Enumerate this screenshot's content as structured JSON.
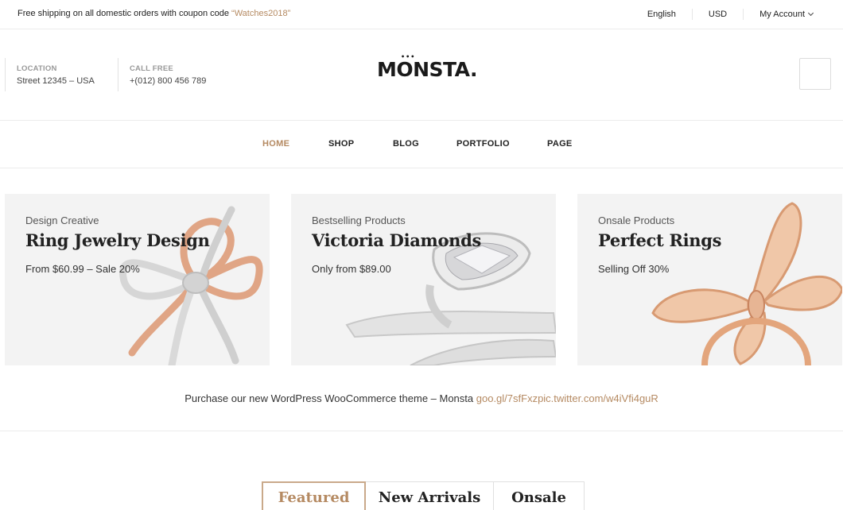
{
  "topbar": {
    "promo_text": "Free shipping on all domestic orders with coupon code ",
    "promo_code": "“Watches2018”",
    "language": "English",
    "currency": "USD",
    "account": "My Account"
  },
  "header": {
    "location_label": "LOCATION",
    "location_value": "Street 12345 – USA",
    "call_label": "CALL FREE",
    "call_value": "+(012) 800 456 789",
    "logo": "MONSTA."
  },
  "nav": {
    "items": [
      "HOME",
      "SHOP",
      "BLOG",
      "PORTFOLIO",
      "PAGE"
    ],
    "active": "HOME"
  },
  "banners": [
    {
      "subtitle": "Design Creative",
      "title": "Ring Jewelry Design",
      "desc": "From $60.99 – Sale 20%"
    },
    {
      "subtitle": "Bestselling Products",
      "title": "Victoria Diamonds",
      "desc": "Only from $89.00"
    },
    {
      "subtitle": "Onsale Products",
      "title": "Perfect Rings",
      "desc": "Selling Off 30%"
    }
  ],
  "tweet": {
    "text": "Purchase our new WordPress WooCommerce theme – Monsta ",
    "link": "goo.gl/7sfFxzpic.twitter.com/w4iVfi4guR"
  },
  "tabs": {
    "items": [
      "Featured",
      "New Arrivals",
      "Onsale"
    ],
    "active": "Featured"
  },
  "colors": {
    "accent": "#b58a62",
    "banner_bg": "#f3f3f3",
    "border": "#ececec",
    "rose_gold": "#e0a585",
    "silver": "#d9d9d9"
  },
  "icons": [
    "chevron-down-icon",
    "cart-icon"
  ]
}
